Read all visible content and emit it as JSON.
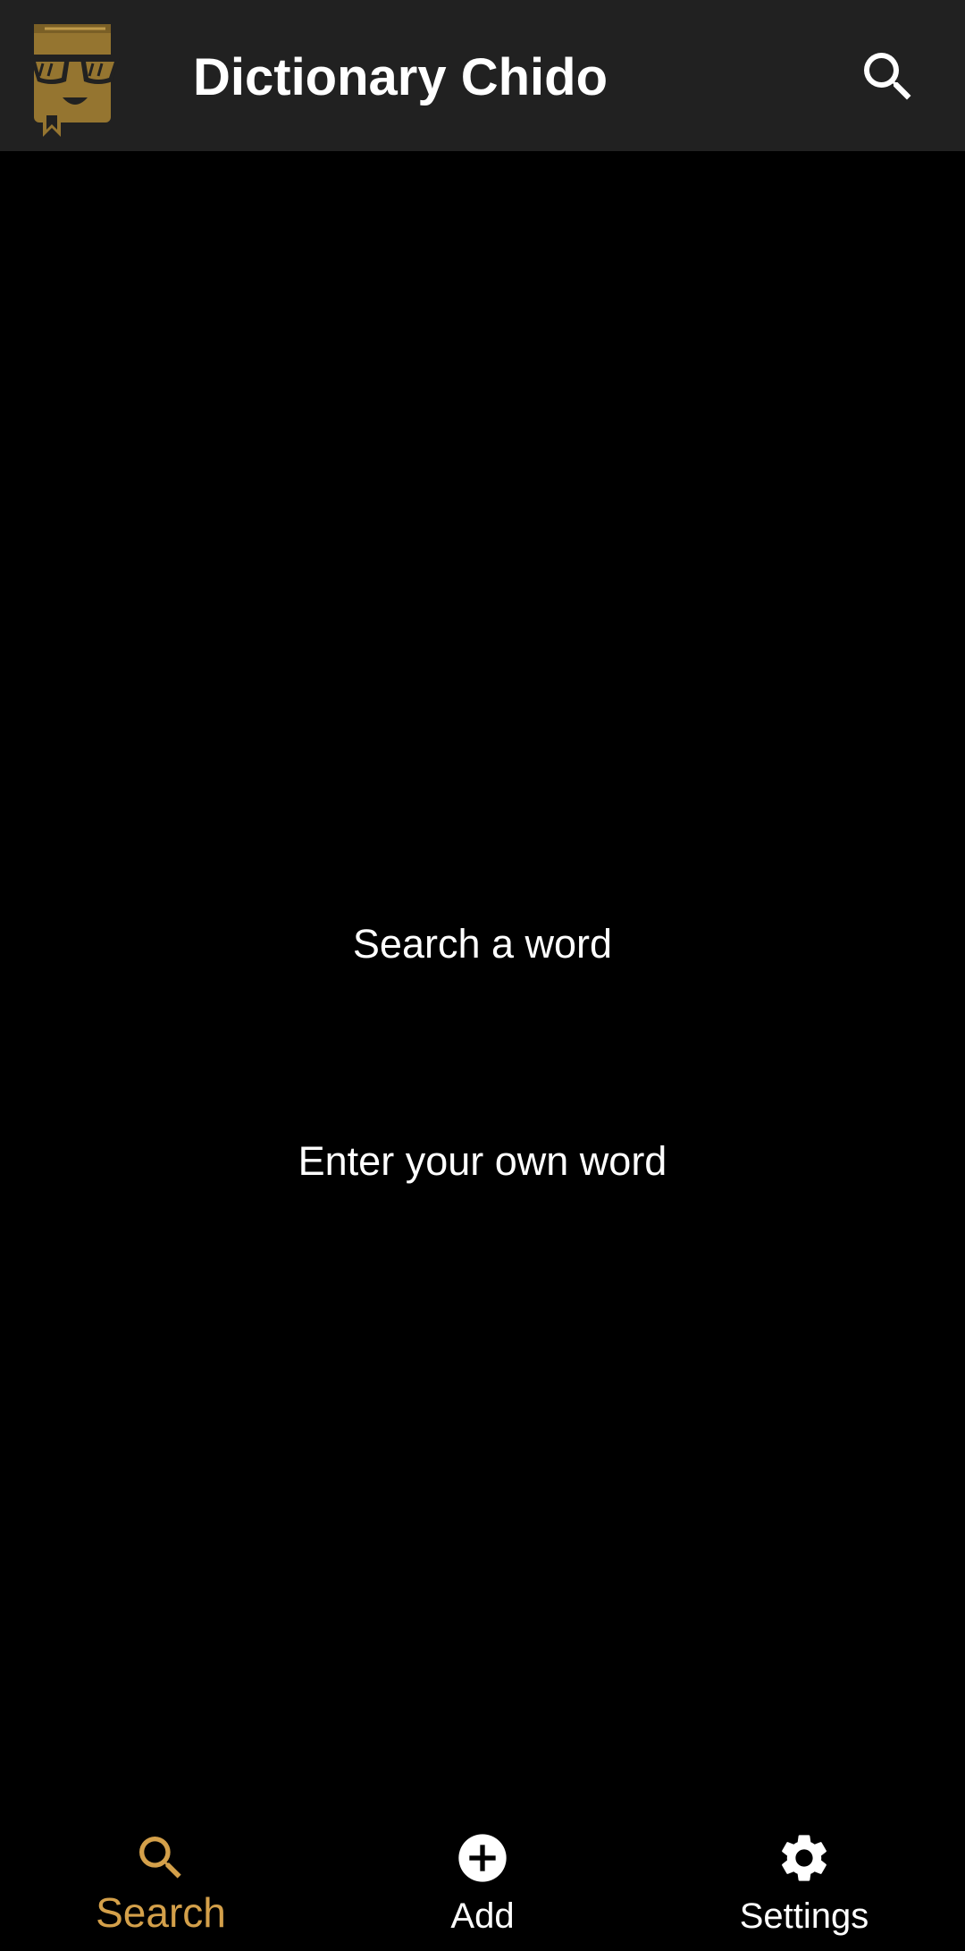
{
  "app_bar": {
    "title": "Dictionary Chido",
    "logo_icon": "sunglasses-book-icon",
    "action_icon": "search-icon"
  },
  "main": {
    "search_link": "Search a word",
    "add_link": "Enter your own word"
  },
  "bottom_nav": {
    "items": [
      {
        "label": "Search",
        "icon": "search-icon",
        "active": true
      },
      {
        "label": "Add",
        "icon": "add-circle-icon",
        "active": false
      },
      {
        "label": "Settings",
        "icon": "gear-icon",
        "active": false
      }
    ]
  },
  "colors": {
    "app_bar_bg": "#212121",
    "background": "#000000",
    "accent": "#d4a04a",
    "logo": "#957530",
    "text": "#ffffff"
  }
}
